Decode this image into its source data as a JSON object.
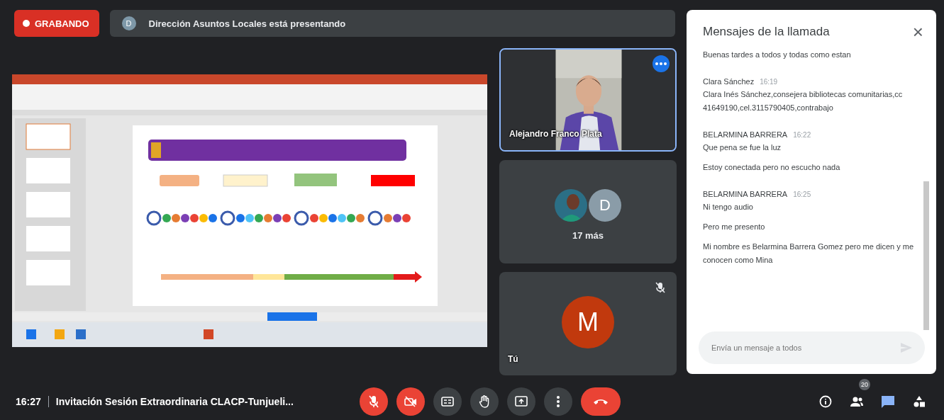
{
  "recording": {
    "label": "GRABANDO"
  },
  "presenting": {
    "avatar": "D",
    "text": "Dirección Asuntos Locales está presentando"
  },
  "tiles": [
    {
      "kind": "video",
      "name": "Alejandro Franco Plata",
      "selected": true
    },
    {
      "kind": "group",
      "avatar": "D",
      "count": "17 más",
      "selected": false
    },
    {
      "kind": "self",
      "avatar": "M",
      "name": "Tú",
      "muted": true,
      "selected": false
    }
  ],
  "chat": {
    "title": "Mensajes de la llamada",
    "close": "×",
    "messages": [
      {
        "texts": [
          "Buenas tardes a todos y todas como estan"
        ]
      },
      {
        "sender": "Clara Sánchez",
        "time": "16:19",
        "texts": [
          "Clara Inés Sánchez,consejera bibliotecas comunitarias,cc 41649190,cel.3115790405,contrabajo"
        ]
      },
      {
        "sender": "BELARMINA BARRERA",
        "time": "16:22",
        "texts": [
          "Que pena se fue la luz",
          "Estoy conectada pero no escucho nada"
        ]
      },
      {
        "sender": "BELARMINA BARRERA",
        "time": "16:25",
        "texts": [
          "Ni tengo audio",
          "Pero me presento",
          "Mi nombre es Belarmina Barrera Gomez pero me dicen y me conocen como Mina"
        ]
      }
    ],
    "input": {
      "placeholder": "Envía un mensaje a todos"
    }
  },
  "bottom_bar": {
    "time": "16:27",
    "title": "Invitación Sesión Extraordinaria CLACP-Tunjueli...",
    "controls": [
      {
        "kind": "mic",
        "on": false
      },
      {
        "kind": "camera",
        "on": false
      },
      {
        "kind": "captions",
        "on": false
      },
      {
        "kind": "hand",
        "on": false
      },
      {
        "kind": "present",
        "on": false
      },
      {
        "kind": "more",
        "on": false
      },
      {
        "kind": "hangup",
        "on": false
      }
    ],
    "side": [
      {
        "kind": "info",
        "selected": false
      },
      {
        "kind": "people",
        "badge": "20",
        "selected": false
      },
      {
        "kind": "chat",
        "selected": true
      },
      {
        "kind": "activities",
        "selected": false
      }
    ]
  }
}
